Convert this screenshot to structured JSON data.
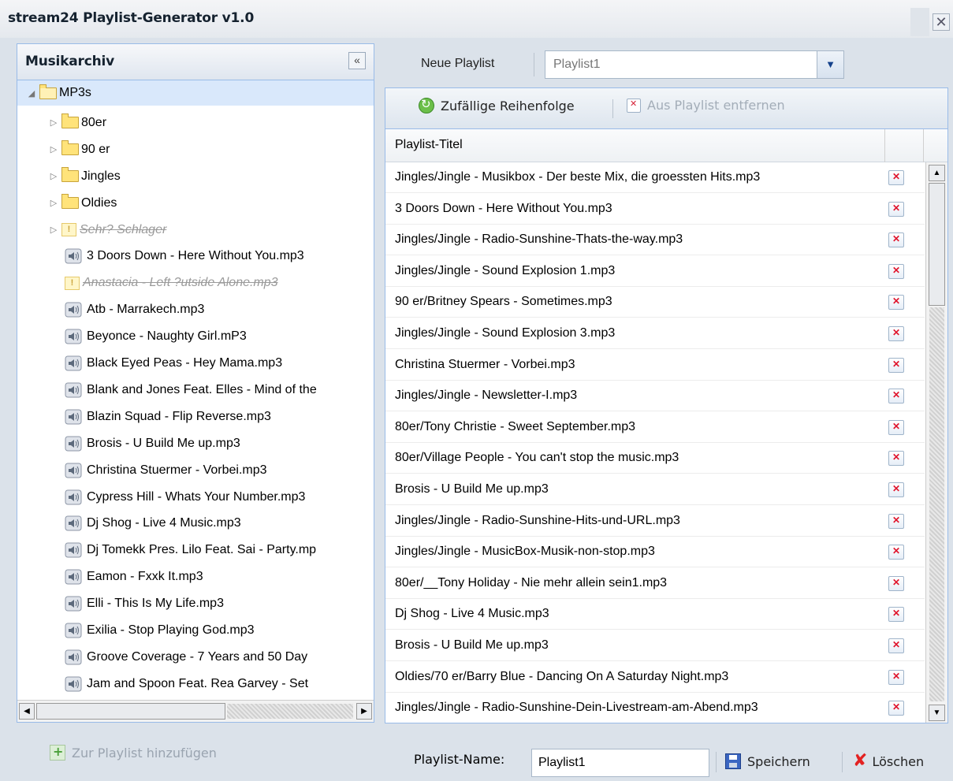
{
  "window": {
    "title": "stream24 Playlist-Generator v1.0",
    "close_glyph": "✕"
  },
  "archive": {
    "title": "Musikarchiv",
    "collapse_glyph": "«",
    "items": [
      {
        "type": "folder",
        "label": "MP3s",
        "expanded": true,
        "level": 0
      },
      {
        "type": "folder",
        "label": "80er",
        "level": 1
      },
      {
        "type": "folder",
        "label": "90 er",
        "level": 1
      },
      {
        "type": "folder",
        "label": "Jingles",
        "level": 1
      },
      {
        "type": "folder",
        "label": "Oldies",
        "level": 1
      },
      {
        "type": "warning-folder",
        "label": "Sehr? Schlager",
        "level": 1
      },
      {
        "type": "audio",
        "label": "3 Doors Down - Here Without You.mp3",
        "level": 1
      },
      {
        "type": "warning",
        "label": "Anastacia - Left ?utside Alone.mp3",
        "level": 1
      },
      {
        "type": "audio",
        "label": "Atb - Marrakech.mp3",
        "level": 1
      },
      {
        "type": "audio",
        "label": "Beyonce - Naughty Girl.mP3",
        "level": 1
      },
      {
        "type": "audio",
        "label": "Black Eyed Peas - Hey Mama.mp3",
        "level": 1
      },
      {
        "type": "audio",
        "label": "Blank and Jones Feat. Elles - Mind of the",
        "level": 1
      },
      {
        "type": "audio",
        "label": "Blazin Squad - Flip Reverse.mp3",
        "level": 1
      },
      {
        "type": "audio",
        "label": "Brosis - U Build Me up.mp3",
        "level": 1
      },
      {
        "type": "audio",
        "label": "Christina Stuermer - Vorbei.mp3",
        "level": 1
      },
      {
        "type": "audio",
        "label": "Cypress Hill - Whats Your Number.mp3",
        "level": 1
      },
      {
        "type": "audio",
        "label": "Dj Shog - Live 4 Music.mp3",
        "level": 1
      },
      {
        "type": "audio",
        "label": "Dj Tomekk Pres. Lilo Feat. Sai - Party.mp",
        "level": 1
      },
      {
        "type": "audio",
        "label": "Eamon - Fxxk It.mp3",
        "level": 1
      },
      {
        "type": "audio",
        "label": "Elli - This Is My Life.mp3",
        "level": 1
      },
      {
        "type": "audio",
        "label": "Exilia - Stop Playing God.mp3",
        "level": 1
      },
      {
        "type": "audio",
        "label": "Groove Coverage - 7 Years and 50 Day",
        "level": 1
      },
      {
        "type": "audio",
        "label": "Jam and Spoon Feat. Rea Garvey - Set",
        "level": 1
      }
    ],
    "add_button": "Zur Playlist hinzufügen"
  },
  "top": {
    "new_playlist_label": "Neue Playlist",
    "combo_value": "Playlist1"
  },
  "toolbar": {
    "shuffle_label": "Zufällige Reihenfolge",
    "remove_label": "Aus Playlist entfernen"
  },
  "grid": {
    "column_title": "Playlist-Titel",
    "rows": [
      "Jingles/Jingle - Musikbox - Der beste Mix, die groessten Hits.mp3",
      "3 Doors Down - Here Without You.mp3",
      "Jingles/Jingle - Radio-Sunshine-Thats-the-way.mp3",
      "Jingles/Jingle - Sound Explosion 1.mp3",
      "90 er/Britney Spears - Sometimes.mp3",
      "Jingles/Jingle - Sound Explosion 3.mp3",
      "Christina Stuermer - Vorbei.mp3",
      "Jingles/Jingle - Newsletter-I.mp3",
      "80er/Tony Christie - Sweet September.mp3",
      "80er/Village People - You can't stop the music.mp3",
      "Brosis - U Build Me up.mp3",
      "Jingles/Jingle - Radio-Sunshine-Hits-und-URL.mp3",
      "Jingles/Jingle - MusicBox-Musik-non-stop.mp3",
      "80er/__Tony Holiday - Nie mehr allein sein1.mp3",
      "Dj Shog - Live 4 Music.mp3",
      "Brosis - U Build Me up.mp3",
      "Oldies/70 er/Barry Blue - Dancing On A Saturday Night.mp3",
      "Jingles/Jingle - Radio-Sunshine-Dein-Livestream-am-Abend.mp3"
    ]
  },
  "bottom": {
    "name_label": "Playlist-Name:",
    "name_value": "Playlist1",
    "save_label": "Speichern",
    "delete_label": "Löschen"
  },
  "colors": {
    "panel_border": "#99bbe8",
    "selected_row": "#d9e8fb",
    "remove_red": "#e0142c"
  }
}
